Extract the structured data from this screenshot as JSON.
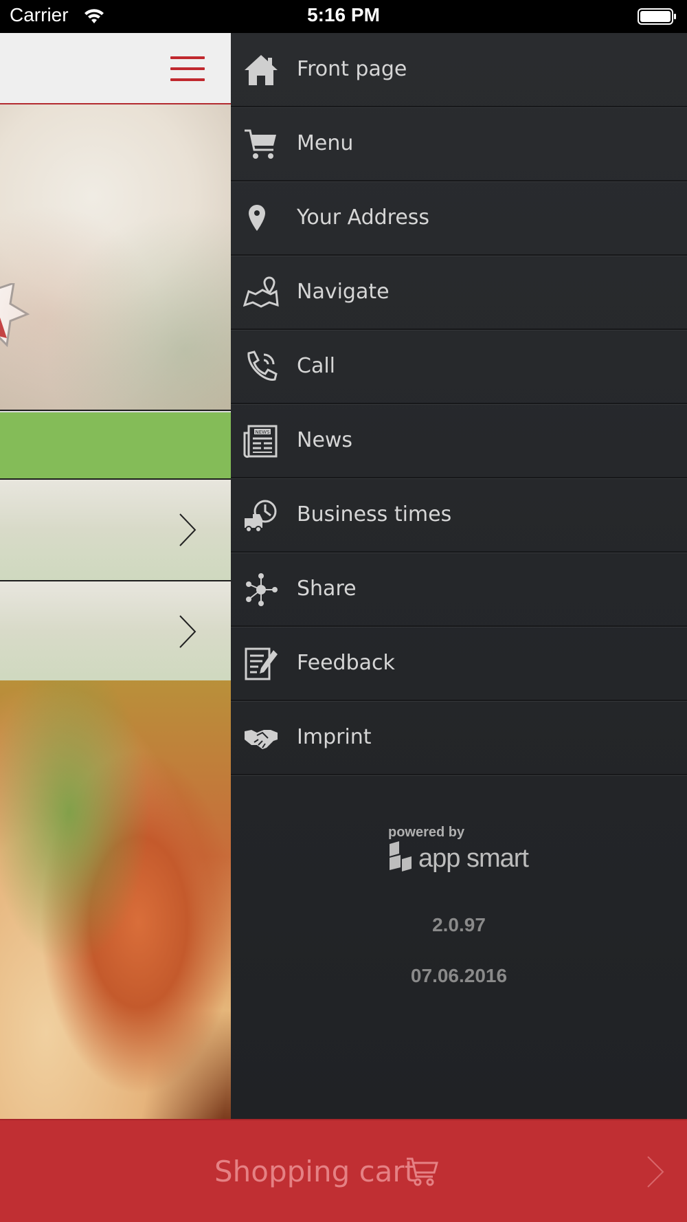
{
  "status_bar": {
    "carrier": "Carrier",
    "time": "5:16 PM"
  },
  "colors": {
    "brand_red": "#c02f33",
    "accent_green": "#84bc58",
    "drawer_bg": "#25272a",
    "menu_text": "#d6d6d6"
  },
  "drawer": {
    "items": [
      {
        "label": "Front page",
        "icon": "home-icon"
      },
      {
        "label": "Menu",
        "icon": "cart-icon"
      },
      {
        "label": "Your Address",
        "icon": "location-pin-icon"
      },
      {
        "label": "Navigate",
        "icon": "map-icon"
      },
      {
        "label": "Call",
        "icon": "phone-icon"
      },
      {
        "label": "News",
        "icon": "newspaper-icon"
      },
      {
        "label": "Business times",
        "icon": "delivery-clock-icon"
      },
      {
        "label": "Share",
        "icon": "share-icon"
      },
      {
        "label": "Feedback",
        "icon": "feedback-icon"
      },
      {
        "label": "Imprint",
        "icon": "handshake-icon"
      }
    ],
    "news_icon_text": "NEWS",
    "powered_by": "powered by",
    "brand_logo_text": "app smart",
    "version": "2.0.97",
    "date": "07.06.2016"
  },
  "cart_bar": {
    "label": "Shopping cart"
  }
}
